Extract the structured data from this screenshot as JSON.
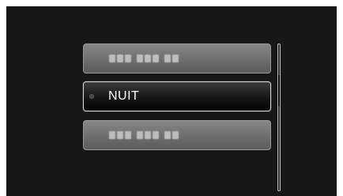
{
  "menu": {
    "items": [
      {
        "label": "",
        "state": "dim"
      },
      {
        "label": "NUIT",
        "state": "selected"
      },
      {
        "label": "",
        "state": "dim"
      }
    ]
  },
  "colors": {
    "screen_background": "#171717",
    "dim_item": "#707070",
    "selected_item": "#161616",
    "selected_text": "#ffffff"
  },
  "scrollbar": {
    "position_fraction": 0.33
  }
}
